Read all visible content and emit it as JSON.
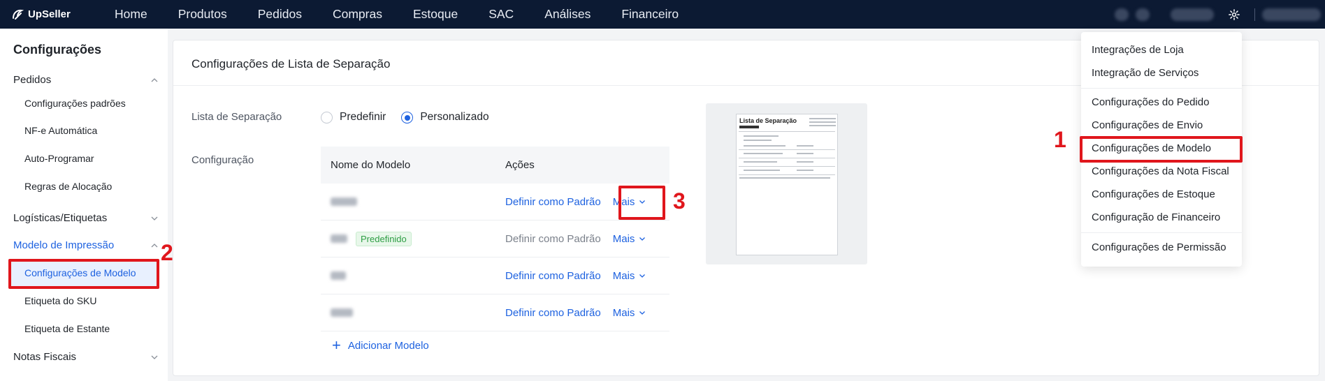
{
  "topbar": {
    "logo": "UpSeller",
    "nav": [
      "Home",
      "Produtos",
      "Pedidos",
      "Compras",
      "Estoque",
      "SAC",
      "Análises",
      "Financeiro"
    ]
  },
  "sidebar": {
    "title": "Configurações",
    "groups": [
      {
        "label": "Pedidos",
        "expanded": true,
        "items": [
          "Configurações padrões",
          "NF-e Automática",
          "Auto-Programar",
          "Regras de Alocação"
        ]
      },
      {
        "label": "Logísticas/Etiquetas",
        "expanded": false
      },
      {
        "label": "Modelo de Impressão",
        "expanded": true,
        "items": [
          "Configurações de Modelo",
          "Etiqueta do SKU",
          "Etiqueta de Estante"
        ]
      },
      {
        "label": "Notas Fiscais",
        "expanded": false
      }
    ]
  },
  "main": {
    "title": "Configurações de Lista de Separação",
    "picklist_label": "Lista de Separação",
    "radio_options": [
      "Predefinir",
      "Personalizado"
    ],
    "selected_option": "Personalizado",
    "config_label": "Configuração",
    "table": {
      "headers": [
        "Nome do Modelo",
        "Ações"
      ],
      "rows": [
        {
          "badge": "",
          "action": "Definir como Padrão",
          "more": "Mais"
        },
        {
          "badge": "Predefinido",
          "action": "Definir como Padrão",
          "more": "Mais"
        },
        {
          "badge": "",
          "action": "Definir como Padrão",
          "more": "Mais"
        },
        {
          "badge": "",
          "action": "Definir como Padrão",
          "more": "Mais"
        }
      ]
    },
    "add_model": "Adicionar Modelo",
    "preview_title": "Lista de Separação"
  },
  "dropdown": {
    "sections": [
      [
        "Integrações de Loja",
        "Integração de Serviços"
      ],
      [
        "Configurações do Pedido",
        "Configurações de Envio",
        "Configurações de Modelo",
        "Configurações da Nota Fiscal",
        "Configurações de Estoque",
        "Configuração de Financeiro"
      ],
      [
        "Configurações de Permissão"
      ]
    ]
  },
  "annotations": {
    "step1": "1",
    "step2": "2",
    "step3": "3"
  },
  "colors": {
    "topbar": "#0c1a33",
    "accent": "#1e62e0",
    "highlight": "#e0161c",
    "badge": "#2e9e44"
  }
}
